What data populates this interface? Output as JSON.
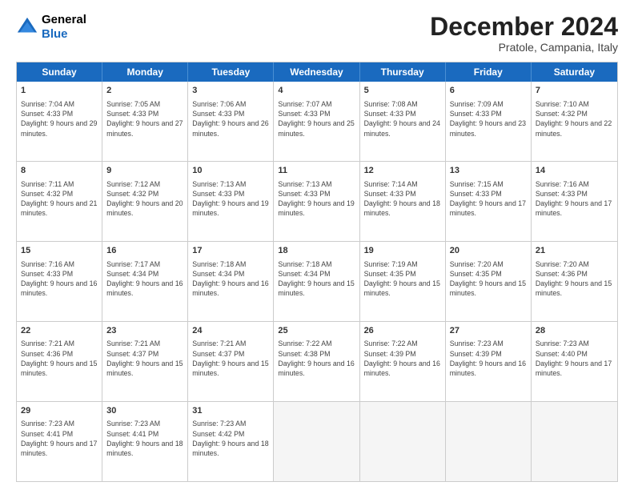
{
  "header": {
    "logo_line1": "General",
    "logo_line2": "Blue",
    "month_title": "December 2024",
    "location": "Pratole, Campania, Italy"
  },
  "weekdays": [
    "Sunday",
    "Monday",
    "Tuesday",
    "Wednesday",
    "Thursday",
    "Friday",
    "Saturday"
  ],
  "rows": [
    [
      {
        "day": "1",
        "sunrise": "7:04 AM",
        "sunset": "4:33 PM",
        "daylight": "9 hours and 29 minutes."
      },
      {
        "day": "2",
        "sunrise": "7:05 AM",
        "sunset": "4:33 PM",
        "daylight": "9 hours and 27 minutes."
      },
      {
        "day": "3",
        "sunrise": "7:06 AM",
        "sunset": "4:33 PM",
        "daylight": "9 hours and 26 minutes."
      },
      {
        "day": "4",
        "sunrise": "7:07 AM",
        "sunset": "4:33 PM",
        "daylight": "9 hours and 25 minutes."
      },
      {
        "day": "5",
        "sunrise": "7:08 AM",
        "sunset": "4:33 PM",
        "daylight": "9 hours and 24 minutes."
      },
      {
        "day": "6",
        "sunrise": "7:09 AM",
        "sunset": "4:33 PM",
        "daylight": "9 hours and 23 minutes."
      },
      {
        "day": "7",
        "sunrise": "7:10 AM",
        "sunset": "4:32 PM",
        "daylight": "9 hours and 22 minutes."
      }
    ],
    [
      {
        "day": "8",
        "sunrise": "7:11 AM",
        "sunset": "4:32 PM",
        "daylight": "9 hours and 21 minutes."
      },
      {
        "day": "9",
        "sunrise": "7:12 AM",
        "sunset": "4:32 PM",
        "daylight": "9 hours and 20 minutes."
      },
      {
        "day": "10",
        "sunrise": "7:13 AM",
        "sunset": "4:33 PM",
        "daylight": "9 hours and 19 minutes."
      },
      {
        "day": "11",
        "sunrise": "7:13 AM",
        "sunset": "4:33 PM",
        "daylight": "9 hours and 19 minutes."
      },
      {
        "day": "12",
        "sunrise": "7:14 AM",
        "sunset": "4:33 PM",
        "daylight": "9 hours and 18 minutes."
      },
      {
        "day": "13",
        "sunrise": "7:15 AM",
        "sunset": "4:33 PM",
        "daylight": "9 hours and 17 minutes."
      },
      {
        "day": "14",
        "sunrise": "7:16 AM",
        "sunset": "4:33 PM",
        "daylight": "9 hours and 17 minutes."
      }
    ],
    [
      {
        "day": "15",
        "sunrise": "7:16 AM",
        "sunset": "4:33 PM",
        "daylight": "9 hours and 16 minutes."
      },
      {
        "day": "16",
        "sunrise": "7:17 AM",
        "sunset": "4:34 PM",
        "daylight": "9 hours and 16 minutes."
      },
      {
        "day": "17",
        "sunrise": "7:18 AM",
        "sunset": "4:34 PM",
        "daylight": "9 hours and 16 minutes."
      },
      {
        "day": "18",
        "sunrise": "7:18 AM",
        "sunset": "4:34 PM",
        "daylight": "9 hours and 15 minutes."
      },
      {
        "day": "19",
        "sunrise": "7:19 AM",
        "sunset": "4:35 PM",
        "daylight": "9 hours and 15 minutes."
      },
      {
        "day": "20",
        "sunrise": "7:20 AM",
        "sunset": "4:35 PM",
        "daylight": "9 hours and 15 minutes."
      },
      {
        "day": "21",
        "sunrise": "7:20 AM",
        "sunset": "4:36 PM",
        "daylight": "9 hours and 15 minutes."
      }
    ],
    [
      {
        "day": "22",
        "sunrise": "7:21 AM",
        "sunset": "4:36 PM",
        "daylight": "9 hours and 15 minutes."
      },
      {
        "day": "23",
        "sunrise": "7:21 AM",
        "sunset": "4:37 PM",
        "daylight": "9 hours and 15 minutes."
      },
      {
        "day": "24",
        "sunrise": "7:21 AM",
        "sunset": "4:37 PM",
        "daylight": "9 hours and 15 minutes."
      },
      {
        "day": "25",
        "sunrise": "7:22 AM",
        "sunset": "4:38 PM",
        "daylight": "9 hours and 16 minutes."
      },
      {
        "day": "26",
        "sunrise": "7:22 AM",
        "sunset": "4:39 PM",
        "daylight": "9 hours and 16 minutes."
      },
      {
        "day": "27",
        "sunrise": "7:23 AM",
        "sunset": "4:39 PM",
        "daylight": "9 hours and 16 minutes."
      },
      {
        "day": "28",
        "sunrise": "7:23 AM",
        "sunset": "4:40 PM",
        "daylight": "9 hours and 17 minutes."
      }
    ],
    [
      {
        "day": "29",
        "sunrise": "7:23 AM",
        "sunset": "4:41 PM",
        "daylight": "9 hours and 17 minutes."
      },
      {
        "day": "30",
        "sunrise": "7:23 AM",
        "sunset": "4:41 PM",
        "daylight": "9 hours and 18 minutes."
      },
      {
        "day": "31",
        "sunrise": "7:23 AM",
        "sunset": "4:42 PM",
        "daylight": "9 hours and 18 minutes."
      },
      null,
      null,
      null,
      null
    ]
  ]
}
